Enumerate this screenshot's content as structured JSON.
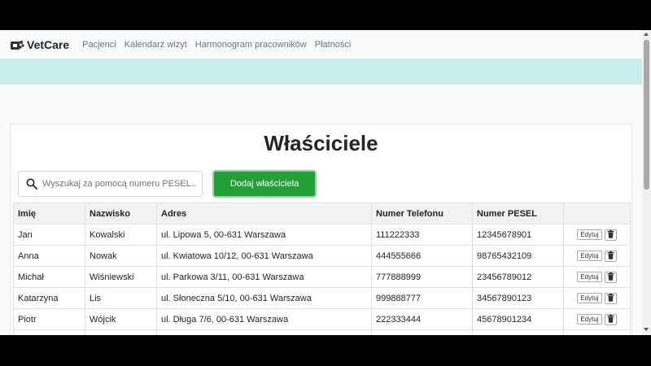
{
  "navbar": {
    "brand": "VetCare",
    "links": [
      "Pacjenci",
      "Kalendarz wizyt",
      "Harmonogram pracowników",
      "Płatności"
    ]
  },
  "page": {
    "title": "Właściciele"
  },
  "search": {
    "placeholder": "Wyszukaj za pomocą numeru PESEL..."
  },
  "add_button": "Dodaj właściciela",
  "table": {
    "headers": [
      "Imię",
      "Nazwisko",
      "Adres",
      "Numer Telefonu",
      "Numer PESEL",
      ""
    ],
    "rows": [
      [
        "Jan",
        "Kowalski",
        "ul. Lipowa 5, 00-631 Warszawa",
        "111222333",
        "12345678901"
      ],
      [
        "Anna",
        "Nowak",
        "ul. Kwiatowa 10/12, 00-631 Warszawa",
        "444555666",
        "98765432109"
      ],
      [
        "Michał",
        "Wiśniewski",
        "ul. Parkowa 3/11, 00-631 Warszawa",
        "777888999",
        "23456789012"
      ],
      [
        "Katarzyna",
        "Lis",
        "ul. Słoneczna 5/10, 00-631 Warszawa",
        "999888777",
        "34567890123"
      ],
      [
        "Piotr",
        "Wójcik",
        "ul. Długa 7/6, 00-631 Warszawa",
        "222333444",
        "45678901234"
      ],
      [
        "",
        "",
        "",
        "",
        ""
      ]
    ],
    "edit_label": "Edytuj",
    "delete_icon": "trash-icon"
  },
  "colors": {
    "accent": "#22a037",
    "hero": "#c9eeec"
  }
}
